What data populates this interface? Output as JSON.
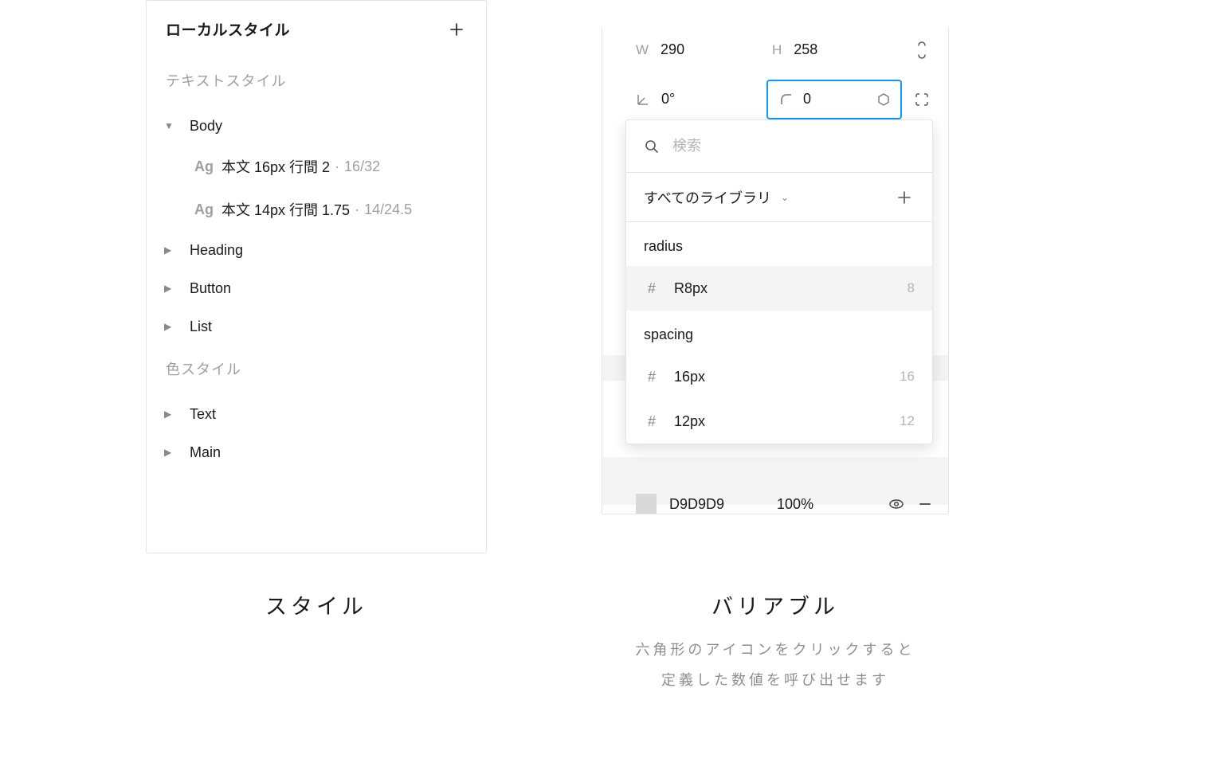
{
  "stylesPanel": {
    "title": "ローカルスタイル",
    "textStylesLabel": "テキストスタイル",
    "colorStylesLabel": "色スタイル",
    "groups": {
      "body": "Body",
      "heading": "Heading",
      "button": "Button",
      "list": "List",
      "text": "Text",
      "main": "Main"
    },
    "items": {
      "body16": {
        "name": "本文 16px 行間 2",
        "meta": "16/32"
      },
      "body14": {
        "name": "本文 14px 行間 1.75",
        "meta": "14/24.5"
      }
    }
  },
  "props": {
    "wKey": "W",
    "wVal": "290",
    "hKey": "H",
    "hVal": "258",
    "rotKey": "",
    "rotVal": "0°",
    "radiusVal": "0"
  },
  "popover": {
    "searchPlaceholder": "検索",
    "filterLabel": "すべてのライブラリ",
    "groups": {
      "radius": "radius",
      "spacing": "spacing"
    },
    "items": {
      "r8": {
        "name": "R8px",
        "value": "8"
      },
      "s16": {
        "name": "16px",
        "value": "16"
      },
      "s12": {
        "name": "12px",
        "value": "12"
      }
    }
  },
  "fill": {
    "hex": "D9D9D9",
    "opacity": "100%"
  },
  "captions": {
    "left": "スタイル",
    "right": "バリアブル",
    "note1": "六角形のアイコンをクリックすると",
    "note2": "定義した数値を呼び出せます"
  },
  "icons": {
    "ag": "Ag"
  }
}
